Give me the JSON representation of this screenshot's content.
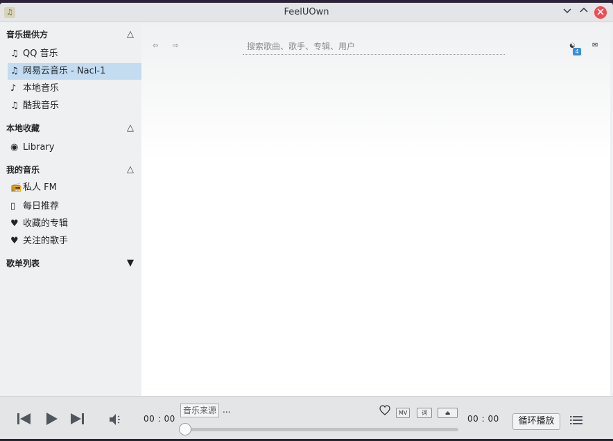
{
  "window": {
    "title": "FeelUOwn",
    "app_icon": "feeluown-logo-icon"
  },
  "titlebar": {
    "minimize_icon": "chevron-down-icon",
    "maximize_icon": "chevron-up-icon",
    "close_icon": "close-icon",
    "close_color": "#ed4c55"
  },
  "sidebar": {
    "providers": {
      "header": "音乐提供方",
      "toggle": "△",
      "items": [
        {
          "label": "QQ 音乐",
          "icon": "♫"
        },
        {
          "label": "网易云音乐 - Nacl-1",
          "icon": "♫",
          "selected": true
        },
        {
          "label": "本地音乐",
          "icon": "♪"
        },
        {
          "label": "酷我音乐",
          "icon": "♫"
        }
      ]
    },
    "collections": {
      "header": "本地收藏",
      "toggle": "△",
      "items": [
        {
          "label": "Library",
          "icon": "◉"
        }
      ]
    },
    "my_music": {
      "header": "我的音乐",
      "toggle": "△",
      "items": [
        {
          "label": "私人 FM",
          "icon": "📻"
        },
        {
          "label": "每日推荐",
          "icon": "▯"
        },
        {
          "label": "收藏的专辑",
          "icon": "♥"
        },
        {
          "label": "关注的歌手",
          "icon": "♥"
        }
      ]
    },
    "playlists": {
      "header": "歌单列表",
      "toggle": "▼"
    }
  },
  "topbar": {
    "back": "⇦",
    "forward": "⇨",
    "search_placeholder": "搜索歌曲、歌手、专辑、用户",
    "notification_icon": "☯",
    "notification_count": "4",
    "mail_icon": "✉",
    "accent": "#3a8fd6"
  },
  "player": {
    "current_time": "00 : 00",
    "total_time": "00 : 00",
    "source_label": "音乐来源",
    "song_title": "...",
    "progress": 0,
    "mv_label": "MV",
    "lyric_label": "词",
    "download_icon": "⏏",
    "play_mode": "循环播放"
  }
}
